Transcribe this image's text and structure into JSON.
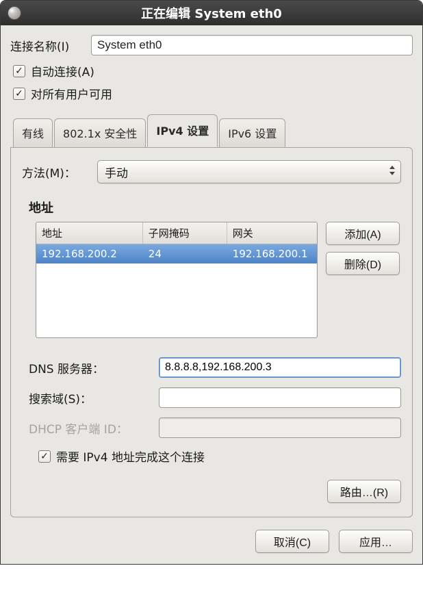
{
  "titlebar": {
    "title": "正在编辑 System eth0"
  },
  "name_row": {
    "label": "连接名称(I)",
    "value": "System eth0"
  },
  "checks": {
    "auto_connect": {
      "label": "自动连接(A)",
      "checked": true
    },
    "all_users": {
      "label": "对所有用户可用",
      "checked": true
    }
  },
  "tabs": {
    "wired": "有线",
    "security": "802.1x 安全性",
    "ipv4": "IPv4 设置",
    "ipv6": "IPv6 设置",
    "active": "ipv4"
  },
  "ipv4": {
    "method_label": "方法(M)：",
    "method_value": "手动",
    "addr_heading": "地址",
    "columns": {
      "addr": "地址",
      "mask": "子网掩码",
      "gw": "网关"
    },
    "rows": [
      {
        "addr": "192.168.200.2",
        "mask": "24",
        "gw": "192.168.200.1",
        "selected": true
      }
    ],
    "buttons": {
      "add": "添加(A)",
      "remove": "删除(D)"
    },
    "dns": {
      "label": "DNS 服务器：",
      "value": "8.8.8.8,192.168.200.3"
    },
    "search": {
      "label": "搜索域(S)：",
      "value": ""
    },
    "dhcp": {
      "label": "DHCP 客户端 ID：",
      "value": ""
    },
    "require": {
      "label": "需要 IPv4 地址完成这个连接",
      "checked": true
    },
    "routes_btn": "路由…(R)"
  },
  "dialog": {
    "cancel": "取消(C)",
    "apply": "应用…"
  }
}
